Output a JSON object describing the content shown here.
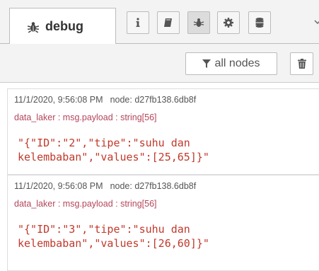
{
  "tab": {
    "label": "debug",
    "icon": "bug-icon"
  },
  "sidebar_buttons": [
    {
      "name": "info-icon",
      "selected": false
    },
    {
      "name": "book-icon",
      "selected": false
    },
    {
      "name": "bug-icon",
      "selected": true
    },
    {
      "name": "gear-icon",
      "selected": false
    },
    {
      "name": "database-icon",
      "selected": false
    }
  ],
  "toolbar": {
    "filter_label": "all nodes",
    "filter_icon": "filter-icon",
    "clear_icon": "trash-icon"
  },
  "messages": [
    {
      "timestamp": "11/1/2020, 9:56:08 PM",
      "node": "node: d27fb138.6db8f",
      "topic": "data_laker : msg.payload : string[56]",
      "payload": "\"{\"ID\":\"2\",\"tipe\":\"suhu dan\nkelembaban\",\"values\":[25,65]}\""
    },
    {
      "timestamp": "11/1/2020, 9:56:08 PM",
      "node": "node: d27fb138.6db8f",
      "topic": "data_laker : msg.payload : string[56]",
      "payload": "\"{\"ID\":\"3\",\"tipe\":\"suhu dan\nkelembaban\",\"values\":[26,60]}\""
    }
  ],
  "colors": {
    "topic": "#b4455a",
    "payload": "#c0392b",
    "tab_bg": "#f3f3f3"
  }
}
